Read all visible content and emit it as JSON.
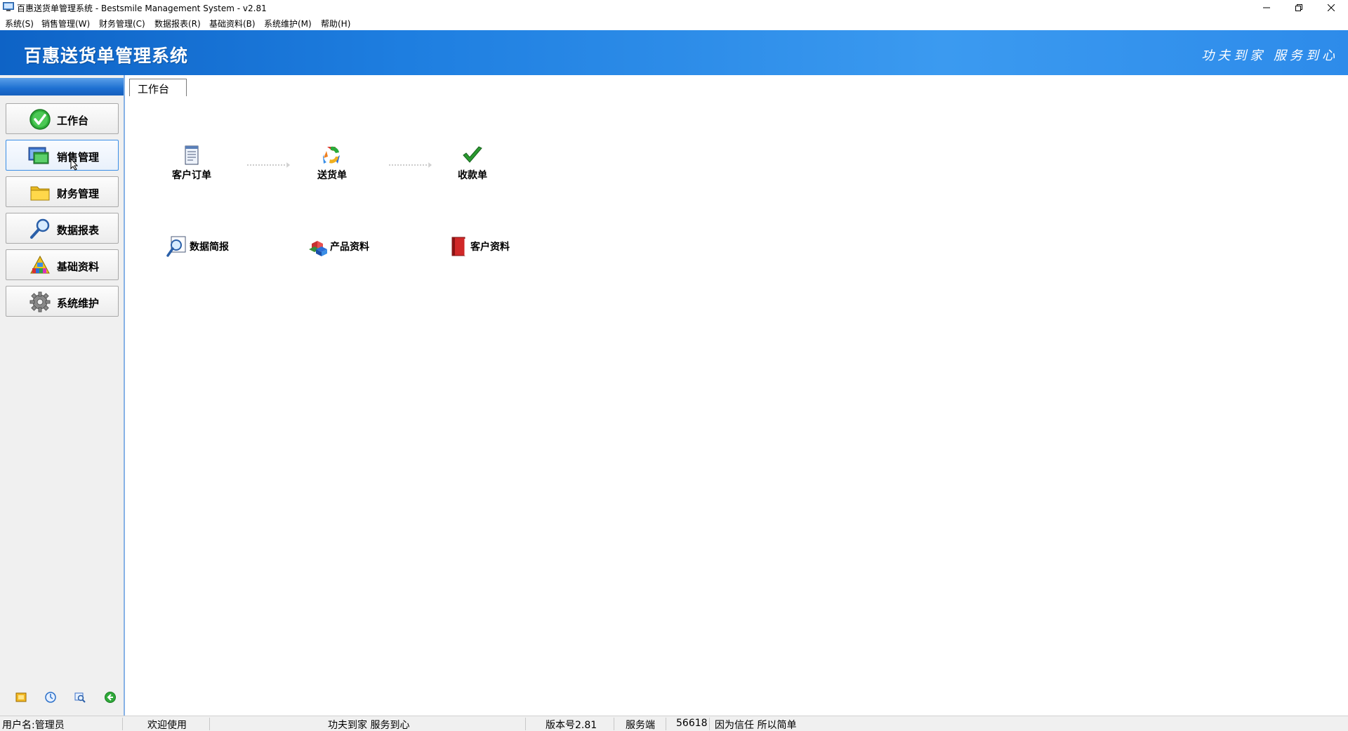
{
  "window": {
    "title": "百惠送货单管理系统 - Bestsmile Management System - v2.81"
  },
  "menubar": {
    "items": [
      {
        "label": "系统(S)"
      },
      {
        "label": "销售管理(W)"
      },
      {
        "label": "财务管理(C)"
      },
      {
        "label": "数据报表(R)"
      },
      {
        "label": "基础资料(B)"
      },
      {
        "label": "系统维护(M)"
      },
      {
        "label": "帮助(H)"
      }
    ]
  },
  "banner": {
    "title": "百惠送货单管理系统",
    "slogan": "功夫到家 服务到心"
  },
  "sidebar": {
    "items": [
      {
        "label": "工作台",
        "icon": "green-check-circle-icon"
      },
      {
        "label": "销售管理",
        "icon": "monitor-window-icon",
        "active": true
      },
      {
        "label": "财务管理",
        "icon": "folder-icon"
      },
      {
        "label": "数据报表",
        "icon": "magnifier-icon"
      },
      {
        "label": "基础资料",
        "icon": "color-chart-icon"
      },
      {
        "label": "系统维护",
        "icon": "gear-icon"
      }
    ],
    "tools": [
      "folder-tool-icon",
      "clock-tool-icon",
      "search-tool-icon",
      "back-tool-icon"
    ]
  },
  "main": {
    "tab_label": "工作台",
    "flow": [
      {
        "label": "客户订单",
        "icon": "order-document-icon"
      },
      {
        "label": "送货单",
        "icon": "recycle-arrows-icon"
      },
      {
        "label": "收款单",
        "icon": "green-checkmark-icon"
      }
    ],
    "shortcuts": [
      {
        "label": "数据简报",
        "icon": "report-magnifier-icon"
      },
      {
        "label": "产品资料",
        "icon": "product-cubes-icon"
      },
      {
        "label": "客户资料",
        "icon": "red-book-icon"
      }
    ]
  },
  "statusbar": {
    "user": "用户名:管理员",
    "welcome": "欢迎使用",
    "slogan": "功夫到家 服务到心",
    "version": "版本号2.81",
    "server_label": "服务端",
    "server_value": "56618",
    "motto": "因为信任 所以简单"
  },
  "colors": {
    "banner_start": "#0e63c6",
    "banner_end": "#3b9af0",
    "active_border": "#3a8ee6"
  }
}
